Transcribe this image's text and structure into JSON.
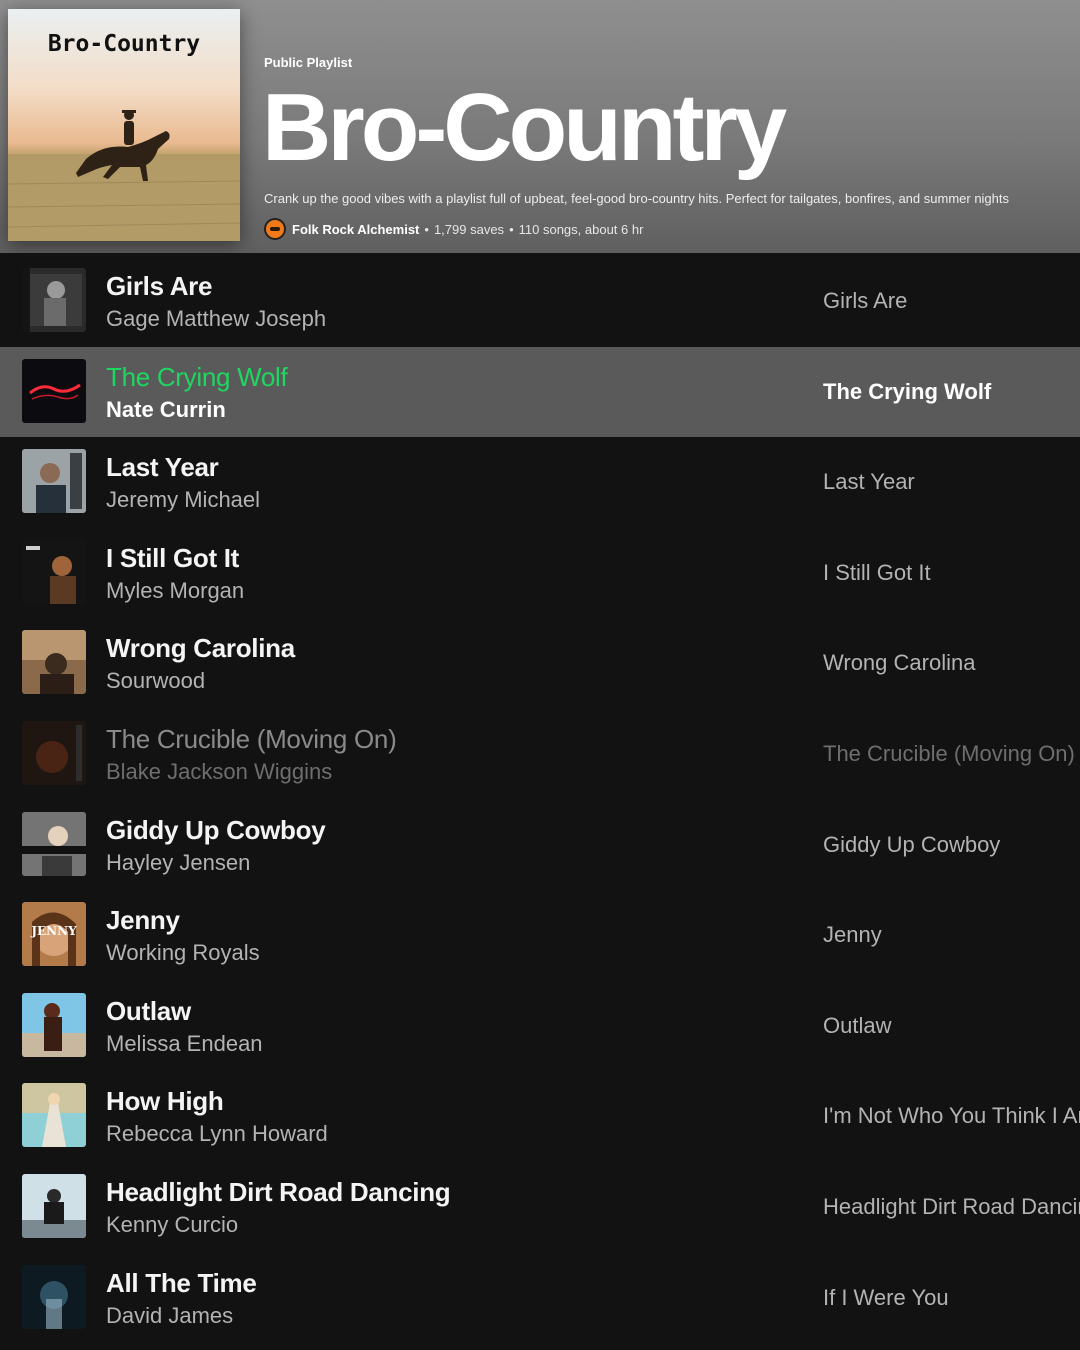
{
  "playlist": {
    "type_label": "Public Playlist",
    "title": "Bro-Country",
    "cover_title": "Bro-Country",
    "description": "Crank up the good vibes with a playlist full of upbeat, feel-good bro-country hits. Perfect for tailgates, bonfires, and summer nights",
    "owner": "Folk Rock Alchemist",
    "saves": "1,799 saves",
    "summary": "110 songs, about 6 hr",
    "separator": "•"
  },
  "tracks": [
    {
      "title": "Girls Are",
      "artist": "Gage Matthew Joseph",
      "album": "Girls Are"
    },
    {
      "title": "The Crying Wolf",
      "artist": "Nate Currin",
      "album": "The Crying Wolf"
    },
    {
      "title": "Last Year",
      "artist": "Jeremy Michael",
      "album": "Last Year"
    },
    {
      "title": "I Still Got It",
      "artist": "Myles Morgan",
      "album": "I Still Got It"
    },
    {
      "title": "Wrong Carolina",
      "artist": "Sourwood",
      "album": "Wrong Carolina"
    },
    {
      "title": "The Crucible (Moving On)",
      "artist": "Blake Jackson Wiggins",
      "album": "The Crucible (Moving On)"
    },
    {
      "title": "Giddy Up Cowboy",
      "artist": "Hayley Jensen",
      "album": "Giddy Up Cowboy"
    },
    {
      "title": "Jenny",
      "artist": "Working Royals",
      "album": "Jenny"
    },
    {
      "title": "Outlaw",
      "artist": "Melissa Endean",
      "album": "Outlaw"
    },
    {
      "title": "How High",
      "artist": "Rebecca Lynn Howard",
      "album": "I'm Not Who You Think I Am"
    },
    {
      "title": "Headlight Dirt Road Dancing",
      "artist": "Kenny Curcio",
      "album": "Headlight Dirt Road Dancing"
    },
    {
      "title": "All The Time",
      "artist": "David James",
      "album": "If I Were You"
    }
  ],
  "thumb_art": {
    "jenny_word": "JENNY"
  },
  "colors": {
    "active_title": "#1ed760",
    "background": "#121212",
    "active_row": "#5a5a5a"
  }
}
